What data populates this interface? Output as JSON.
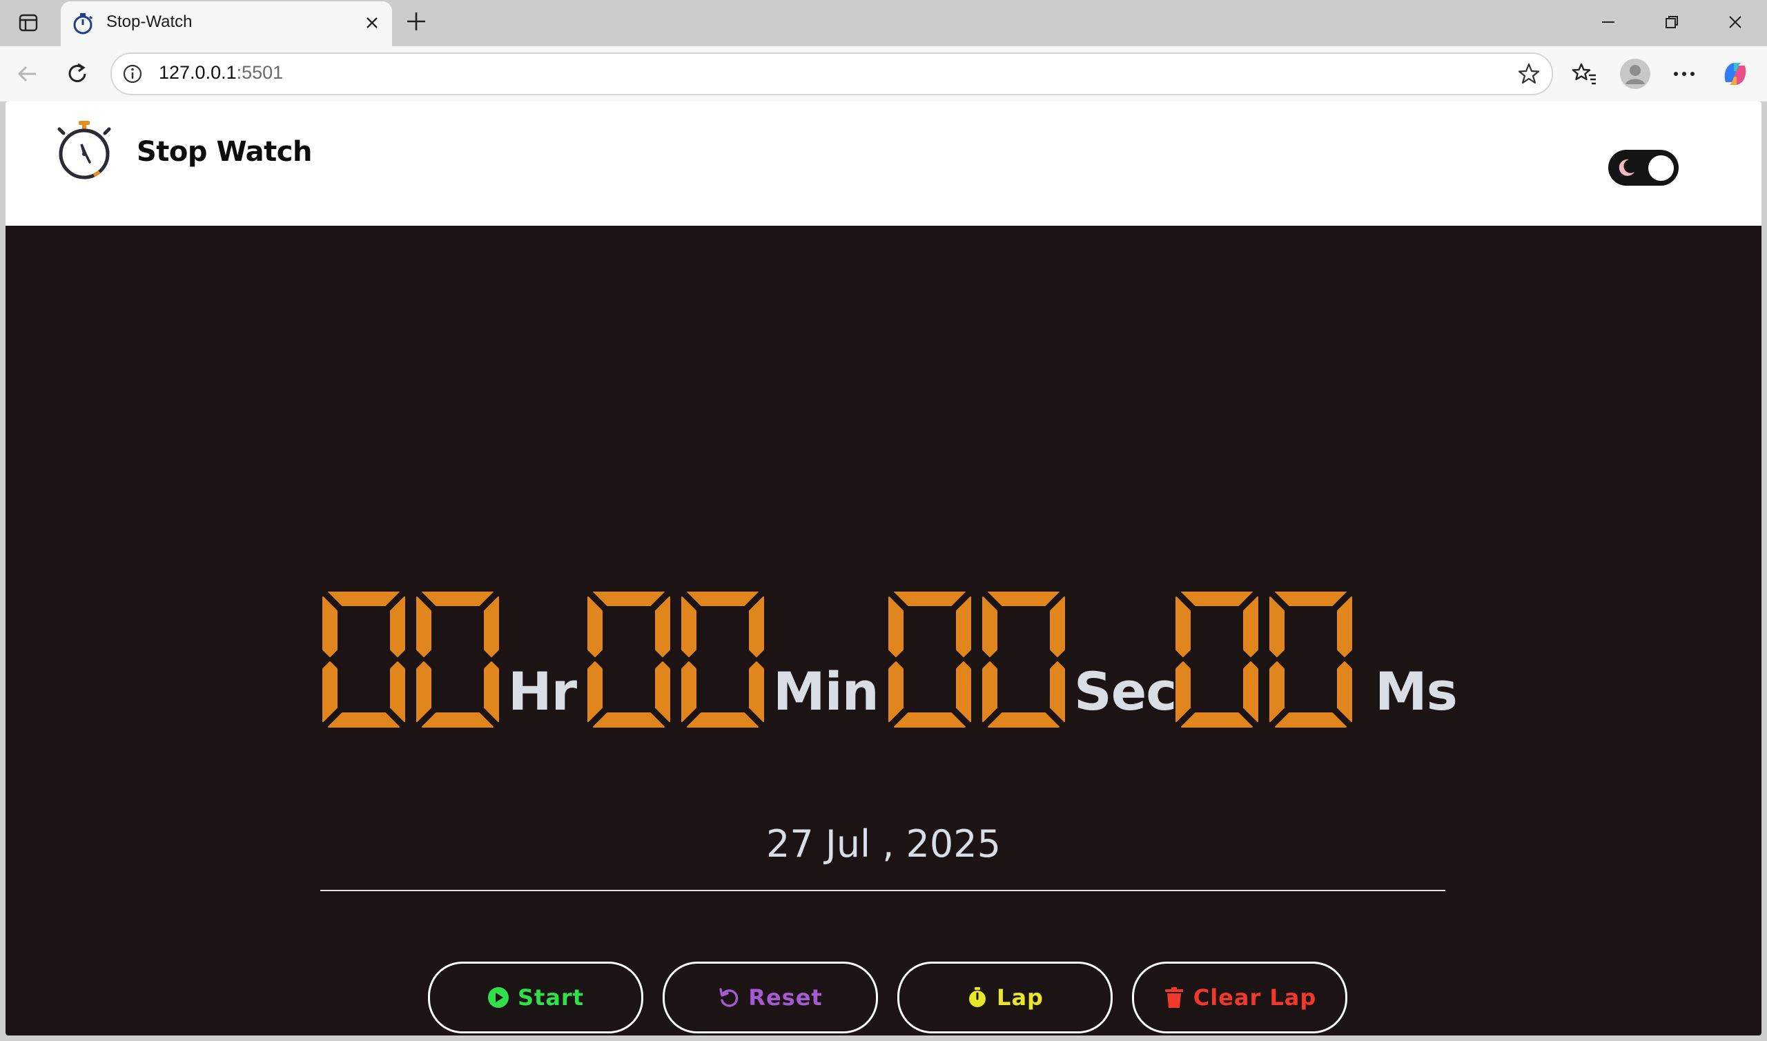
{
  "browser": {
    "tab_title": "Stop-Watch",
    "url_host": "127.0.0.1",
    "url_port": ":5501"
  },
  "app": {
    "title": "Stop Watch",
    "theme_toggle_state": "dark"
  },
  "timer": {
    "hours": "00",
    "minutes": "00",
    "seconds": "00",
    "milliseconds": "00",
    "hours_unit": "Hr",
    "minutes_unit": "Min",
    "seconds_unit": "Sec",
    "milliseconds_unit": "Ms",
    "digit_color": "#e0861c"
  },
  "date": "27 Jul , 2025",
  "controls": {
    "start": {
      "label": "Start",
      "color": "#2fe04b",
      "icon": "play-circle-icon"
    },
    "reset": {
      "label": "Reset",
      "color": "#a55ad1",
      "icon": "rotate-left-icon"
    },
    "lap": {
      "label": "Lap",
      "color": "#e6e62a",
      "icon": "stopwatch-icon"
    },
    "clear_lap": {
      "label": "Clear Lap",
      "color": "#f0392a",
      "icon": "trash-icon"
    }
  }
}
